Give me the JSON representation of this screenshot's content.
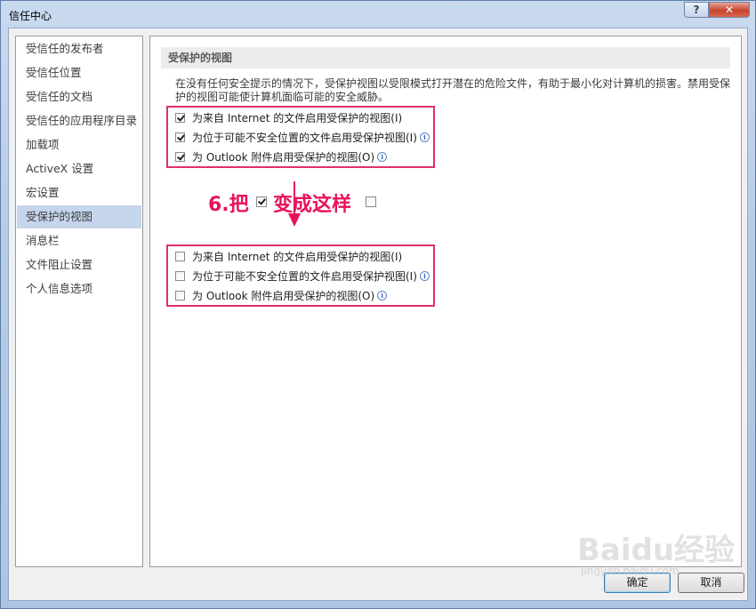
{
  "window": {
    "title": "信任中心",
    "help_label": "?",
    "close_label": "✕"
  },
  "nav": {
    "items": [
      {
        "label": "受信任的发布者"
      },
      {
        "label": "受信任位置"
      },
      {
        "label": "受信任的文档"
      },
      {
        "label": "受信任的应用程序目录"
      },
      {
        "label": "加载项"
      },
      {
        "label": "ActiveX 设置"
      },
      {
        "label": "宏设置"
      },
      {
        "label": "受保护的视图",
        "selected": true
      },
      {
        "label": "消息栏"
      },
      {
        "label": "文件阻止设置"
      },
      {
        "label": "个人信息选项"
      }
    ]
  },
  "main": {
    "section_title": "受保护的视图",
    "description": "在没有任何安全提示的情况下，受保护视图以受限模式打开潜在的危险文件，有助于最小化对计算机的损害。禁用受保护的视图可能使计算机面临可能的安全威胁。",
    "options_before": [
      {
        "label": "为来自 Internet 的文件启用受保护的视图(I)",
        "checked": true,
        "info": false
      },
      {
        "label": "为位于可能不安全位置的文件启用受保护视图(I)",
        "checked": true,
        "info": true
      },
      {
        "label": "为 Outlook 附件启用受保护的视图(O)",
        "checked": true,
        "info": true
      }
    ],
    "options_after": [
      {
        "label": "为来自 Internet 的文件启用受保护的视图(I)",
        "checked": false,
        "info": false
      },
      {
        "label": "为位于可能不安全位置的文件启用受保护视图(I)",
        "checked": false,
        "info": true
      },
      {
        "label": "为 Outlook 附件启用受保护的视图(O)",
        "checked": false,
        "info": true
      }
    ]
  },
  "annotation": {
    "part1": "6.把",
    "part2": "变成这样",
    "color": "#e8125c"
  },
  "buttons": {
    "ok": "确定",
    "cancel": "取消"
  },
  "watermark": {
    "text": "Baidu经验",
    "sub": "jingyan.baidu.com"
  }
}
